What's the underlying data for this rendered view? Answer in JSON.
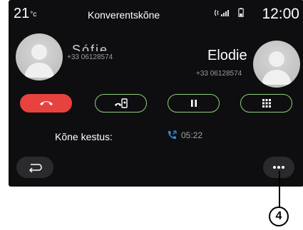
{
  "status": {
    "temperature": "21",
    "temperature_unit": "°c",
    "clock": "12:00"
  },
  "header": {
    "title": "Konverentskõne"
  },
  "caller1": {
    "name": "Sófie",
    "number": "+33 06128574"
  },
  "caller2": {
    "name": "Elodie",
    "number": "+33 06128574"
  },
  "call": {
    "duration_label": "Kõne kestus:",
    "duration_value": "05:22"
  },
  "callout": {
    "label": "4"
  },
  "colors": {
    "screen_bg": "#0e0e10",
    "end_call": "#e8423f",
    "button_outline": "#8ecf7b",
    "phone_icon": "#2f8be0"
  },
  "icons": {
    "end_call": "phone-hangup-icon",
    "transfer": "phone-transfer-icon",
    "pause": "pause-icon",
    "keypad": "keypad-icon",
    "back": "back-arrow-icon",
    "more": "more-options-icon",
    "duration": "phone-call-icon",
    "signal": "bluetooth-phone-signal-icon",
    "battery": "battery-icon"
  }
}
